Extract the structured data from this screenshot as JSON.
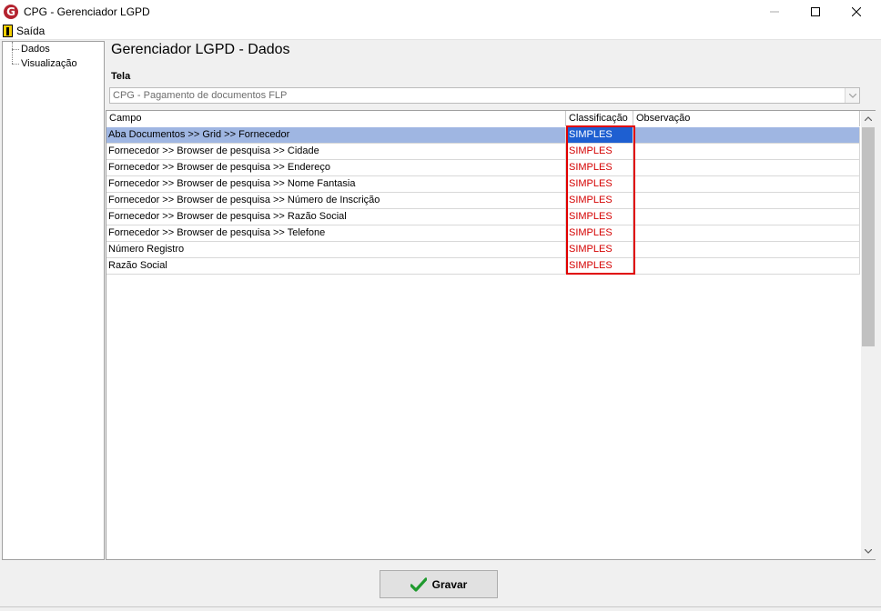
{
  "window": {
    "title": "CPG - Gerenciador LGPD",
    "logo_letter": "G"
  },
  "menu": {
    "exit_label": "Saída"
  },
  "tree": {
    "items": [
      {
        "label": "Dados"
      },
      {
        "label": "Visualização"
      }
    ]
  },
  "page": {
    "title": "Gerenciador LGPD - Dados",
    "tela_label": "Tela",
    "tela_value": "CPG - Pagamento de documentos FLP"
  },
  "grid": {
    "columns": [
      "Campo",
      "Classificação",
      "Observação"
    ],
    "rows": [
      {
        "campo": "Aba Documentos >> Grid >> Fornecedor",
        "classificacao": "SIMPLES",
        "observacao": ""
      },
      {
        "campo": "Fornecedor >> Browser de pesquisa >> Cidade",
        "classificacao": "SIMPLES",
        "observacao": ""
      },
      {
        "campo": "Fornecedor >> Browser de pesquisa >> Endereço",
        "classificacao": "SIMPLES",
        "observacao": ""
      },
      {
        "campo": "Fornecedor >> Browser de pesquisa >> Nome Fantasia",
        "classificacao": "SIMPLES",
        "observacao": ""
      },
      {
        "campo": "Fornecedor >> Browser de pesquisa >> Número de Inscrição",
        "classificacao": "SIMPLES",
        "observacao": ""
      },
      {
        "campo": "Fornecedor >> Browser de pesquisa >> Razão Social",
        "classificacao": "SIMPLES",
        "observacao": ""
      },
      {
        "campo": "Fornecedor >> Browser de pesquisa >> Telefone",
        "classificacao": "SIMPLES",
        "observacao": ""
      },
      {
        "campo": "Número Registro",
        "classificacao": "SIMPLES",
        "observacao": ""
      },
      {
        "campo": "Razão Social",
        "classificacao": "SIMPLES",
        "observacao": ""
      }
    ]
  },
  "footer": {
    "save_label": "Gravar"
  },
  "colors": {
    "selected_row": "#9fb6e2",
    "selected_cell": "#1e5fd1",
    "classification_text": "#d40000",
    "highlight_border": "#e00000"
  }
}
